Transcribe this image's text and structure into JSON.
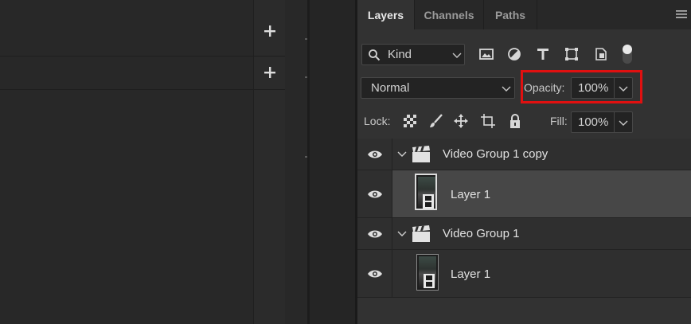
{
  "tabs": [
    {
      "label": "Layers",
      "active": true
    },
    {
      "label": "Channels",
      "active": false
    },
    {
      "label": "Paths",
      "active": false
    }
  ],
  "filter": {
    "kind_label": "Kind"
  },
  "blend": {
    "mode": "Normal",
    "opacity_label": "Opacity:",
    "opacity_value": "100%"
  },
  "lock": {
    "label": "Lock:",
    "fill_label": "Fill:",
    "fill_value": "100%"
  },
  "layers": [
    {
      "name": "Video Group 1 copy",
      "type": "group",
      "visible": true,
      "expanded": true
    },
    {
      "name": "Layer 1",
      "type": "video-layer",
      "visible": true,
      "selected": true
    },
    {
      "name": "Video Group 1",
      "type": "group",
      "visible": true,
      "expanded": true
    },
    {
      "name": "Layer 1",
      "type": "video-layer",
      "visible": true,
      "selected": false
    }
  ],
  "colors": {
    "highlight": "#e01010",
    "panel_bg": "#323232",
    "selected_row": "#474747"
  }
}
